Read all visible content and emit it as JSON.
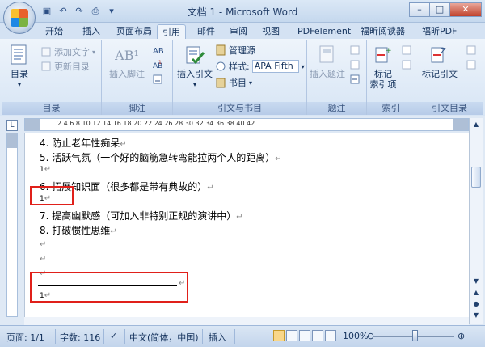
{
  "window": {
    "title": "文档 1 - Microsoft Word",
    "min": "–",
    "max": "□",
    "close": "✕"
  },
  "qat": [
    "save-icon",
    "undo-icon",
    "redo-icon",
    "print-preview-icon",
    "customize-icon"
  ],
  "tabs": [
    "开始",
    "插入",
    "页面布局",
    "引用",
    "邮件",
    "审阅",
    "视图",
    "PDFelement",
    "福昕阅读器",
    "福昕PDF"
  ],
  "active_tab": "引用",
  "ribbon": {
    "toc": {
      "label": "目录",
      "add_text": "添加文字",
      "update": "更新目录",
      "group": "目录"
    },
    "footnote": {
      "insert": "插入脚注",
      "ab_icon": "AB¹",
      "group": "脚注"
    },
    "citation": {
      "insert": "插入引文",
      "manage": "管理源",
      "style_label": "样式:",
      "style_value": "APA Fifth",
      "bibliography": "书目",
      "group": "引文与书目"
    },
    "caption": {
      "insert": "插入题注",
      "group": "题注"
    },
    "index": {
      "mark": "标记",
      "mark2": "索引项",
      "group": "索引"
    },
    "toa": {
      "mark": "标记引文",
      "group": "引文目录"
    }
  },
  "ruler": {
    "box": "L",
    "numbers": "2    4    6    8    10   12   14   16   18   20   22   24   26   28   30   32   34   36   38   40   42"
  },
  "document": {
    "lines": [
      "4. 防止老年性痴呆",
      "5. 活跃气氛（一个好的脑筋急转弯能拉两个人的距离）",
      "1",
      "6. 拓展知识面（很多都是带有典故的）",
      "1",
      "7. 提高幽默感（可加入非特别正规的演讲中）",
      "8. 打破惯性思维",
      "",
      "",
      "",
      "1"
    ],
    "para_mark": "↵"
  },
  "status": {
    "page": "页面: 1/1",
    "words": "字数: 116",
    "language": "中文(简体，中国)",
    "mode": "插入",
    "zoom": "100%",
    "zoom_level": 1.0
  },
  "colors": {
    "highlight_box": "#e0201a",
    "ribbon_bg": "#eef4fb"
  }
}
